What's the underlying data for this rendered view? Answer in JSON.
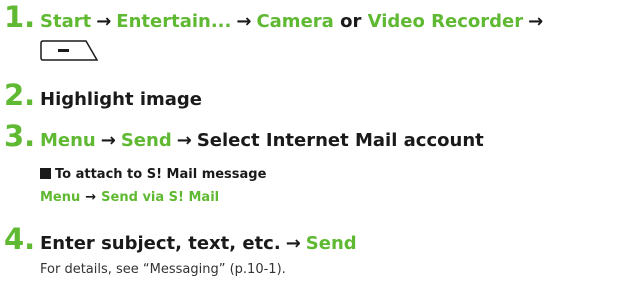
{
  "colors": {
    "accent": "#5fb932",
    "text": "#1a1a1a"
  },
  "steps": [
    {
      "num": "1.",
      "start": "Start",
      "entertain": "Entertain...",
      "camera": "Camera",
      "or": "or",
      "video": "Video Recorder"
    },
    {
      "num": "2.",
      "text": "Highlight image"
    },
    {
      "num": "3.",
      "menu": "Menu",
      "send": "Send",
      "select": "Select Internet Mail account"
    },
    {
      "num": "4.",
      "enter": "Enter subject, text, etc.",
      "send": "Send"
    }
  ],
  "sub": {
    "heading": "To attach to S! Mail message",
    "menu": "Menu",
    "send_via": "Send via S! Mail"
  },
  "note": "For details, see “Messaging” (p.10-1).",
  "arrow": "→",
  "softkey_icon": "right-softkey-icon"
}
